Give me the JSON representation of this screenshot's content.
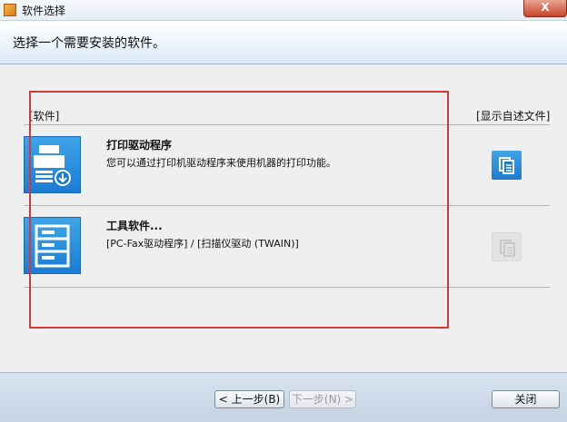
{
  "window": {
    "title": "软件选择",
    "close_label": "X"
  },
  "header": {
    "instruction": "选择一个需要安装的软件。"
  },
  "columns": {
    "software": "[软件]",
    "readme": "[显示自述文件]"
  },
  "items": [
    {
      "title": "打印驱动程序",
      "description": "您可以通过打印机驱动程序来使用机器的打印功能。",
      "icon": "printer-install-icon",
      "readme_enabled": true
    },
    {
      "title": "工具软件...",
      "description": "[PC-Fax驱动程序] / [扫描仪驱动 (TWAIN)]",
      "icon": "document-list-icon",
      "readme_enabled": false
    }
  ],
  "footer": {
    "back_label": "< 上一步(B)",
    "next_label": "下一步(N) >",
    "close_label": "关闭"
  },
  "colors": {
    "tile_blue": "#1b7bd3",
    "highlight_red": "#d4383d",
    "header_gradient_end": "#dbe9f7"
  }
}
